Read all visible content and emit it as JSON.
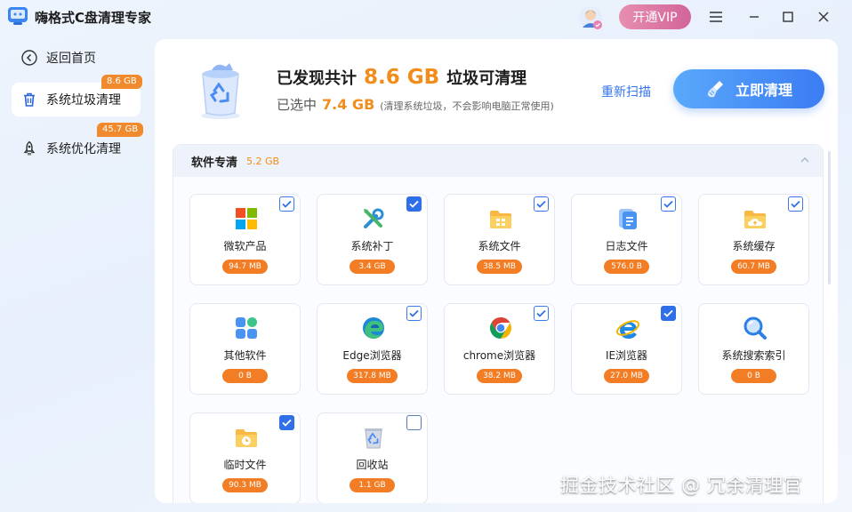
{
  "app": {
    "title": "嗨格式C盘清理专家",
    "vip_label": "开通VIP"
  },
  "sidebar": {
    "back_label": "返回首页",
    "items": [
      {
        "label": "系统垃圾清理",
        "badge": "8.6 GB",
        "icon": "trash-icon"
      },
      {
        "label": "系统优化清理",
        "badge": "45.7 GB",
        "icon": "rocket-icon"
      }
    ]
  },
  "summary": {
    "found_prefix": "已发现共计",
    "found_size": "8.6 GB",
    "found_suffix": "垃圾可清理",
    "selected_prefix": "已选中",
    "selected_size": "7.4 GB",
    "note": "(清理系统垃圾，不会影响电脑正常使用)",
    "rescan_label": "重新扫描",
    "clean_label": "立即清理"
  },
  "category": {
    "title": "软件专清",
    "size": "5.2 GB",
    "items": [
      {
        "label": "微软产品",
        "size": "94.7 MB",
        "checked": true,
        "icon": "windows-icon"
      },
      {
        "label": "系统补丁",
        "size": "3.4 GB",
        "checked": true,
        "icon": "tools-icon"
      },
      {
        "label": "系统文件",
        "size": "38.5 MB",
        "checked": true,
        "icon": "folder-icon"
      },
      {
        "label": "日志文件",
        "size": "576.0 B",
        "checked": true,
        "icon": "document-icon"
      },
      {
        "label": "系统缓存",
        "size": "60.7 MB",
        "checked": true,
        "icon": "cloud-folder-icon"
      },
      {
        "label": "其他软件",
        "size": "0 B",
        "checked": false,
        "icon": "apps-icon"
      },
      {
        "label": "Edge浏览器",
        "size": "317.8 MB",
        "checked": true,
        "icon": "edge-icon"
      },
      {
        "label": "chrome浏览器",
        "size": "38.2 MB",
        "checked": true,
        "icon": "chrome-icon"
      },
      {
        "label": "IE浏览器",
        "size": "27.0 MB",
        "checked": true,
        "icon": "ie-icon"
      },
      {
        "label": "系统搜索索引",
        "size": "0 B",
        "checked": false,
        "icon": "search-icon"
      },
      {
        "label": "临时文件",
        "size": "90.3 MB",
        "checked": true,
        "icon": "clock-folder-icon"
      },
      {
        "label": "回收站",
        "size": "1.1 GB",
        "checked": false,
        "icon": "recycle-bin-icon"
      }
    ]
  },
  "watermark": "掘金技术社区 @ 冗余清理官",
  "colors": {
    "accent": "#3b7cf3",
    "orange": "#f27d24",
    "vip": "#d2649a"
  }
}
